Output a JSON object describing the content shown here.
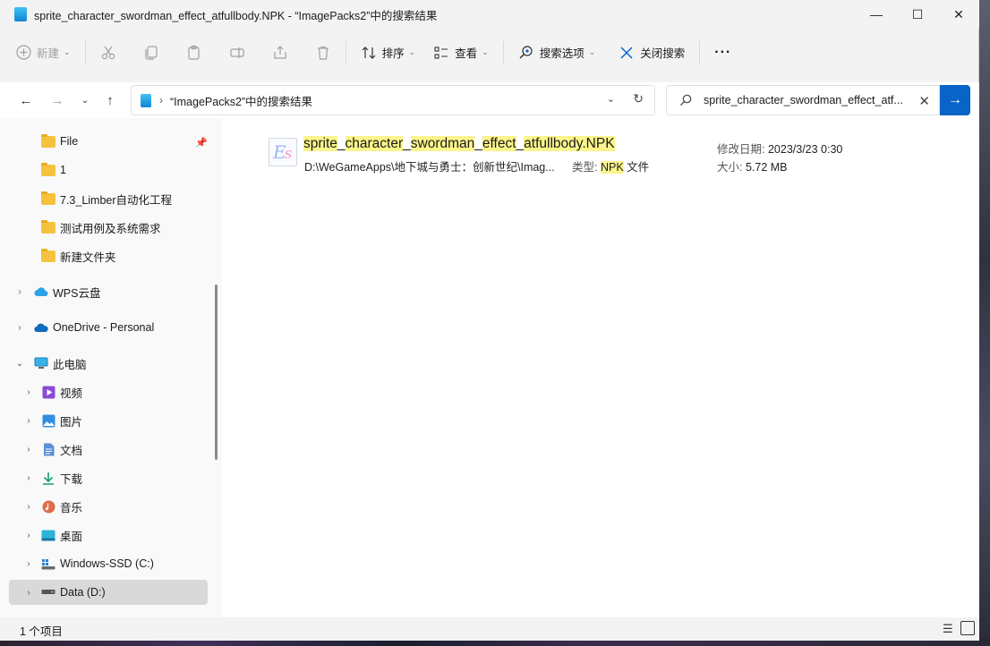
{
  "window": {
    "title": "sprite_character_swordman_effect_atfullbody.NPK - “ImagePacks2”中的搜索结果",
    "controls": {
      "minimize": "—",
      "maximize": "☐",
      "close": "✕"
    }
  },
  "toolbar": {
    "new_label": "新建",
    "sort_label": "排序",
    "view_label": "查看",
    "search_options_label": "搜索选项",
    "close_search_label": "关闭搜索",
    "more_label": "···",
    "icons": [
      "plus-circle-icon",
      "scissors-icon",
      "copy-icon",
      "paste-icon",
      "rename-icon",
      "share-icon",
      "delete-icon",
      "sort-icon",
      "view-icon",
      "search-options-icon",
      "close-icon"
    ]
  },
  "address": {
    "location": "“ImagePacks2”中的搜索结果"
  },
  "search": {
    "value": "sprite_character_swordman_effect_atf..."
  },
  "sidebar": {
    "items": [
      {
        "label": "File",
        "icon": "folder-icon"
      },
      {
        "label": "1",
        "icon": "folder-icon"
      },
      {
        "label": "7.3_Limber自动化工程",
        "icon": "folder-icon"
      },
      {
        "label": "测试用例及系统需求",
        "icon": "folder-icon"
      },
      {
        "label": "新建文件夹",
        "icon": "folder-icon"
      },
      {
        "label": "WPS云盘",
        "icon": "wps-cloud-icon"
      },
      {
        "label": "OneDrive - Personal",
        "icon": "onedrive-icon"
      },
      {
        "label": "此电脑",
        "icon": "pc-icon"
      },
      {
        "label": "视频",
        "icon": "video-icon"
      },
      {
        "label": "图片",
        "icon": "pictures-icon"
      },
      {
        "label": "文档",
        "icon": "documents-icon"
      },
      {
        "label": "下载",
        "icon": "download-icon"
      },
      {
        "label": "音乐",
        "icon": "music-icon"
      },
      {
        "label": "桌面",
        "icon": "desktop-icon"
      },
      {
        "label": "Windows-SSD (C:)",
        "icon": "drive-c-icon"
      },
      {
        "label": "Data (D:)",
        "icon": "drive-d-icon"
      }
    ]
  },
  "result": {
    "name_parts": [
      {
        "text": "sprite",
        "hl": true
      },
      {
        "text": "_",
        "hl": false
      },
      {
        "text": "character",
        "hl": true
      },
      {
        "text": "_",
        "hl": false
      },
      {
        "text": "swordman",
        "hl": true
      },
      {
        "text": "_",
        "hl": false
      },
      {
        "text": "effect",
        "hl": true
      },
      {
        "text": "_",
        "hl": false
      },
      {
        "text": "atfullbody.NPK",
        "hl": true
      }
    ],
    "path": "D:\\WeGameApps\\地下城与勇士：创新世纪\\Imag...",
    "type_key": "类型:",
    "type_ext": "NPK",
    "type_suffix": " 文件",
    "date_key": "修改日期:",
    "date_value": "2023/3/23 0:30",
    "size_key": "大小:",
    "size_value": "5.72 MB"
  },
  "status": {
    "count": "1 个项目"
  }
}
